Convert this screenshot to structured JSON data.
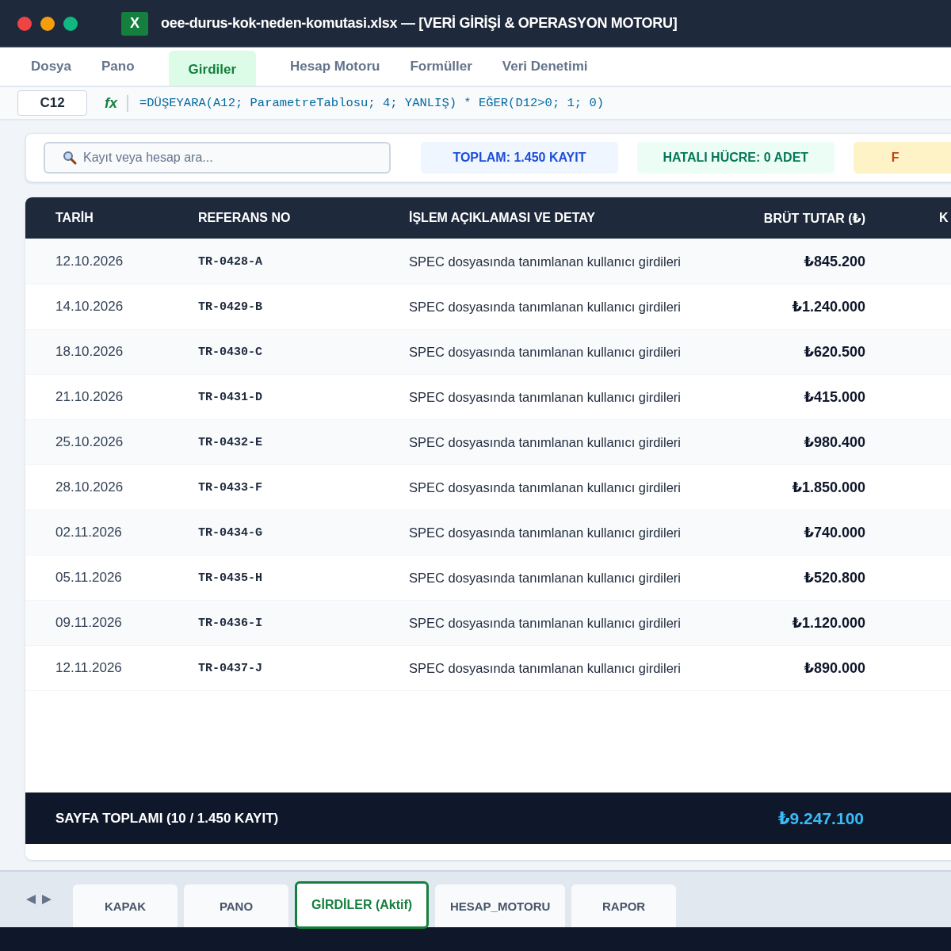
{
  "window": {
    "title": "oee-durus-kok-neden-komutasi.xlsx — [VERİ GİRİŞİ & OPERASYON MOTORU]",
    "app_badge": "X"
  },
  "menu": [
    {
      "label": "Dosya",
      "selected": false
    },
    {
      "label": "Pano",
      "selected": false
    },
    {
      "label": "Girdiler",
      "selected": true
    },
    {
      "label": "Hesap Motoru",
      "selected": false
    },
    {
      "label": "Formüller",
      "selected": false
    },
    {
      "label": "Veri Denetimi",
      "selected": false
    }
  ],
  "formula_bar": {
    "cell": "C12",
    "fx": "fx",
    "formula": "=DÜŞEYARA(A12; ParametreTablosu; 4; YANLIŞ) * EĞER(D12>0; 1; 0)"
  },
  "search": {
    "placeholder": "Kayıt veya hesap ara..."
  },
  "badges": [
    {
      "label": "TOPLAM: 1.450 KAYIT",
      "kind": "info"
    },
    {
      "label": "HATALI HÜCRE: 0 ADET",
      "kind": "ok"
    },
    {
      "label": "F",
      "kind": "warn"
    }
  ],
  "table": {
    "columns": [
      "TARİH",
      "REFERANS NO",
      "İŞLEM AÇIKLAMASI VE DETAY",
      "BRÜT TUTAR (₺)",
      "K"
    ],
    "rows": [
      [
        "12.10.2026",
        "TR-0428-A",
        "SPEC dosyasında tanımlanan kullanıcı girdileri",
        "₺845.200"
      ],
      [
        "14.10.2026",
        "TR-0429-B",
        "SPEC dosyasında tanımlanan kullanıcı girdileri",
        "₺1.240.000"
      ],
      [
        "18.10.2026",
        "TR-0430-C",
        "SPEC dosyasında tanımlanan kullanıcı girdileri",
        "₺620.500"
      ],
      [
        "21.10.2026",
        "TR-0431-D",
        "SPEC dosyasında tanımlanan kullanıcı girdileri",
        "₺415.000"
      ],
      [
        "25.10.2026",
        "TR-0432-E",
        "SPEC dosyasında tanımlanan kullanıcı girdileri",
        "₺980.400"
      ],
      [
        "28.10.2026",
        "TR-0433-F",
        "SPEC dosyasında tanımlanan kullanıcı girdileri",
        "₺1.850.000"
      ],
      [
        "02.11.2026",
        "TR-0434-G",
        "SPEC dosyasında tanımlanan kullanıcı girdileri",
        "₺740.000"
      ],
      [
        "05.11.2026",
        "TR-0435-H",
        "SPEC dosyasında tanımlanan kullanıcı girdileri",
        "₺520.800"
      ],
      [
        "09.11.2026",
        "TR-0436-I",
        "SPEC dosyasında tanımlanan kullanıcı girdileri",
        "₺1.120.000"
      ],
      [
        "12.11.2026",
        "TR-0437-J",
        "SPEC dosyasında tanımlanan kullanıcı girdileri",
        "₺890.000"
      ]
    ],
    "footer": {
      "label": "SAYFA TOPLAMI (10 / 1.450 KAYIT)",
      "total": "₺9.247.100"
    }
  },
  "sheet_tabs": [
    {
      "label": "KAPAK",
      "selected": false
    },
    {
      "label": "PANO",
      "selected": false
    },
    {
      "label": "GİRDİLER (Aktif)",
      "selected": true
    },
    {
      "label": "HESAP_MOTORU",
      "selected": false
    },
    {
      "label": "RAPOR",
      "selected": false
    }
  ]
}
